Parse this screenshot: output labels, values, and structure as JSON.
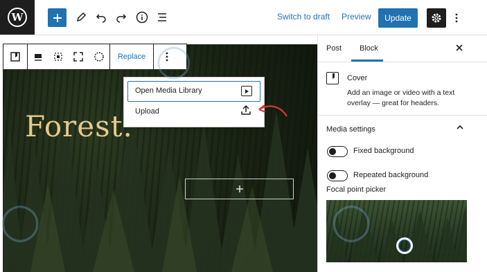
{
  "topbar": {
    "switch_to_draft": "Switch to draft",
    "preview": "Preview",
    "update": "Update",
    "icons": [
      "wordpress-logo",
      "plus-icon",
      "pencil-icon",
      "undo-icon",
      "redo-icon",
      "info-icon",
      "list-view-icon",
      "gear-icon",
      "more-vertical-icon"
    ]
  },
  "block_toolbar": {
    "replace": "Replace",
    "icons": [
      "cover-block-icon",
      "align-icon",
      "full-width-icon",
      "fullscreen-icon",
      "circle-icon",
      "more-vertical-icon"
    ]
  },
  "cover": {
    "title": "Forest."
  },
  "media_menu": {
    "open_media_library": "Open Media Library",
    "upload": "Upload"
  },
  "sidebar": {
    "tabs": [
      "Post",
      "Block"
    ],
    "active_tab": "Block",
    "block_name": "Cover",
    "block_description": "Add an image or video with a text overlay — great for headers.",
    "media_settings": "Media settings",
    "fixed_background": "Fixed background",
    "repeated_background": "Repeated background",
    "focal_point_picker": "Focal point picker"
  },
  "colors": {
    "accent": "#2271b1",
    "dark": "#1e1e1e",
    "title_gold": "#e6c98a"
  }
}
